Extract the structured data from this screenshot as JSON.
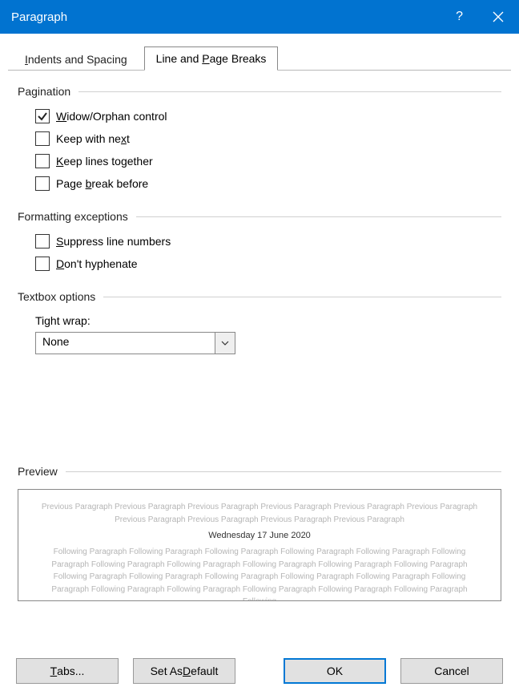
{
  "titlebar": {
    "title": "Paragraph"
  },
  "tabs": {
    "indents": {
      "pre": "",
      "u": "I",
      "post": "ndents and Spacing"
    },
    "line": {
      "pre": "Line and ",
      "u": "P",
      "post": "age Breaks"
    }
  },
  "sections": {
    "pagination": "Pagination",
    "formatting": "Formatting exceptions",
    "textbox": "Textbox options",
    "preview": "Preview"
  },
  "checkboxes": {
    "widow": {
      "checked": true,
      "pre": "",
      "u": "W",
      "post": "idow/Orphan control"
    },
    "keepnext": {
      "checked": false,
      "pre": "Keep with ne",
      "u": "x",
      "post": "t"
    },
    "keeplines": {
      "checked": false,
      "pre": "",
      "u": "K",
      "post": "eep lines together"
    },
    "pagebreak": {
      "checked": false,
      "pre": "Page ",
      "u": "b",
      "post": "reak before"
    },
    "suppress": {
      "checked": false,
      "pre": "",
      "u": "S",
      "post": "uppress line numbers"
    },
    "hyphen": {
      "checked": false,
      "pre": "",
      "u": "D",
      "post": "on't hyphenate"
    }
  },
  "tightwrap": {
    "label": "Tight wrap:",
    "value": "None"
  },
  "preview": {
    "prev_line": "Previous Paragraph Previous Paragraph Previous Paragraph Previous Paragraph Previous Paragraph Previous Paragraph Previous Paragraph Previous Paragraph Previous Paragraph Previous Paragraph",
    "sample": "Wednesday 17 June 2020",
    "next_line": "Following Paragraph Following Paragraph Following Paragraph Following Paragraph Following Paragraph Following Paragraph Following Paragraph Following Paragraph Following Paragraph Following Paragraph Following Paragraph Following Paragraph Following Paragraph Following Paragraph Following Paragraph Following Paragraph Following Paragraph Following Paragraph Following Paragraph Following Paragraph Following Paragraph Following Paragraph Following"
  },
  "buttons": {
    "tabs": {
      "pre": "",
      "u": "T",
      "post": "abs..."
    },
    "setdef": {
      "pre": "Set As ",
      "u": "D",
      "post": "efault"
    },
    "ok": {
      "label": "OK"
    },
    "cancel": {
      "label": "Cancel"
    }
  }
}
